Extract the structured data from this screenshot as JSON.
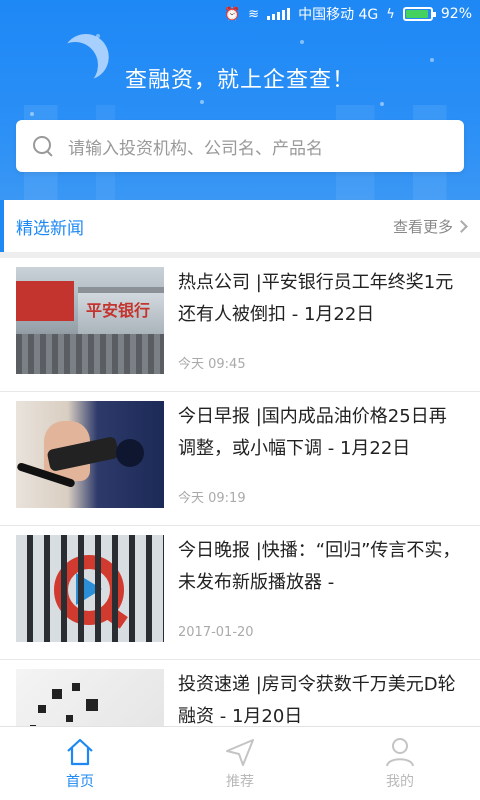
{
  "status_bar": {
    "carrier": "中国移动 4G",
    "battery": "92%",
    "battery_level": 0.92
  },
  "header": {
    "tagline": "查融资，就上企查查！"
  },
  "search": {
    "placeholder": "请输入投资机构、公司名、产品名"
  },
  "section": {
    "title": "精选新闻",
    "more": "查看更多"
  },
  "news": [
    {
      "headline": "热点公司 |平安银行员工年终奖1元 还有人被倒扣 - 1月22日",
      "time": "今天 09:45",
      "thumb_text": "平安银行"
    },
    {
      "headline": "今日早报 |国内成品油价格25日再调整，或小幅下调 - 1月22日",
      "time": "今天 09:19"
    },
    {
      "headline": "今日晚报 |快播：“回归”传言不实，未发布新版播放器 -",
      "time": "2017-01-20"
    },
    {
      "headline": "投资速递 |房司令获数千万美元D轮融资 - 1月20日",
      "time": ""
    }
  ],
  "tabs": [
    {
      "label": "首页",
      "icon": "home-icon",
      "active": true
    },
    {
      "label": "推荐",
      "icon": "send-icon",
      "active": false
    },
    {
      "label": "我的",
      "icon": "person-icon",
      "active": false
    }
  ],
  "colors": {
    "accent": "#1e88f5",
    "battery": "#45d160",
    "muted": "#aaaaaa"
  }
}
